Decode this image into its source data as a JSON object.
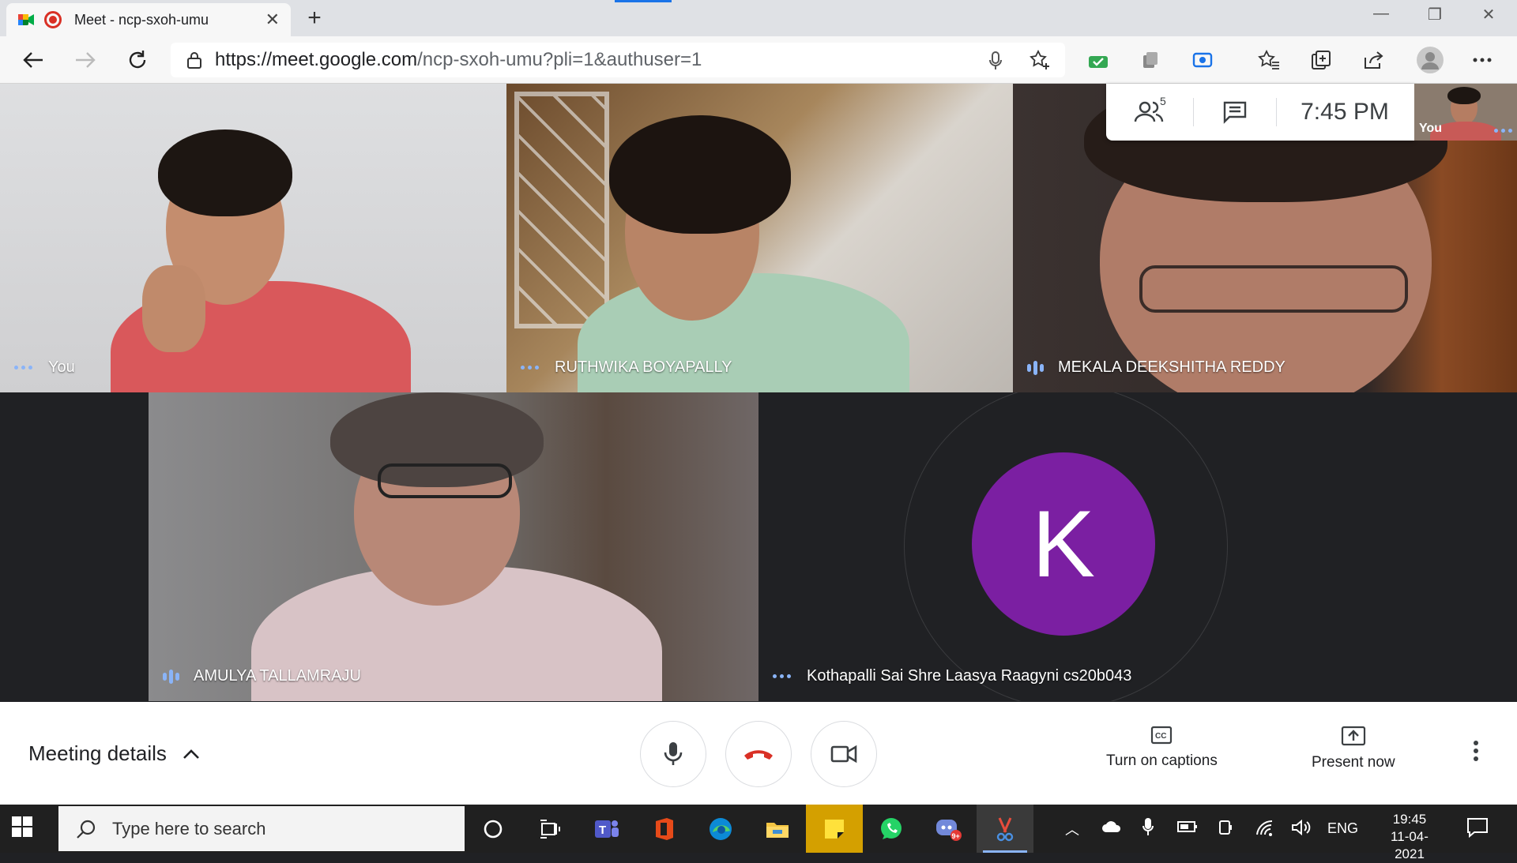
{
  "browser": {
    "tab_title": "Meet - ncp-sxoh-umu",
    "url_host": "https://meet.google.com",
    "url_path": "/ncp-sxoh-umu?pli=1&authuser=1",
    "new_tab_symbol": "+"
  },
  "meeting": {
    "participant_count": "5",
    "time": "7:45 PM",
    "self_preview_label": "You",
    "tiles": [
      {
        "name": "You",
        "indicator": "dots"
      },
      {
        "name": "RUTHWIKA BOYAPALLY",
        "indicator": "dots"
      },
      {
        "name": "MEKALA DEEKSHITHA REDDY",
        "indicator": "bars"
      },
      {
        "name": "AMULYA TALLAMRAJU",
        "indicator": "bars"
      },
      {
        "name": "Kothapalli Sai Shre Laasya Raagyni cs20b043",
        "indicator": "dots",
        "avatar_letter": "K",
        "avatar_color": "#7b1fa2"
      }
    ]
  },
  "controls": {
    "meeting_details": "Meeting details",
    "captions": "Turn on captions",
    "present": "Present now"
  },
  "taskbar": {
    "search_placeholder": "Type here to search",
    "language": "ENG",
    "time": "19:45",
    "date": "11-04-2021",
    "notification_badge": "9+"
  },
  "colors": {
    "accent": "#1a73e8",
    "hangup_red": "#d93025",
    "indicator_blue": "#8ab4f8",
    "stage_bg": "#202124"
  }
}
